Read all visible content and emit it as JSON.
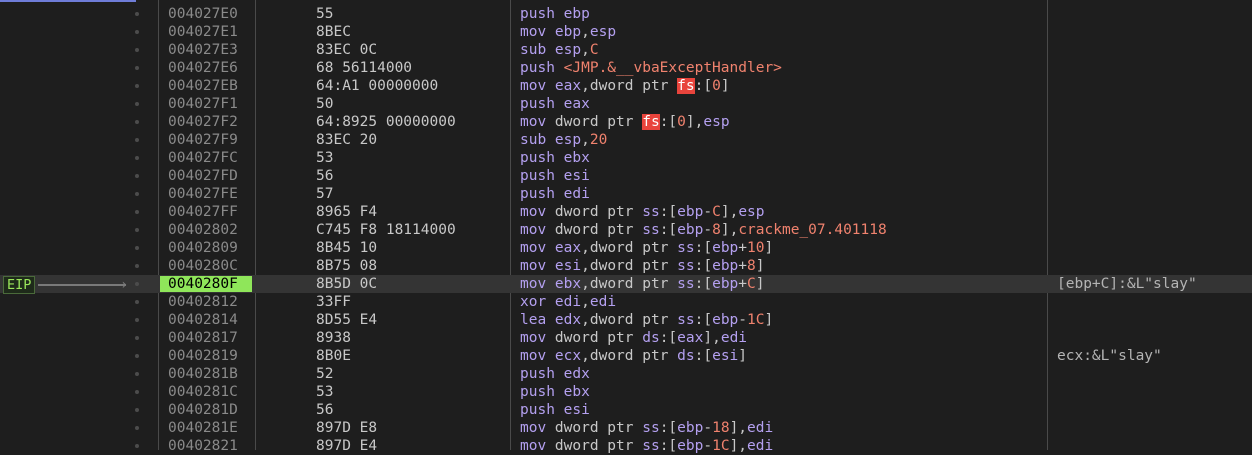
{
  "eip": {
    "label": "EIP",
    "arrow": "›"
  },
  "rows": [
    {
      "addr": "004027E0",
      "bytes": "55",
      "dis": [
        {
          "t": "mn",
          "v": "push "
        },
        {
          "t": "op",
          "v": "ebp"
        }
      ],
      "comment": ""
    },
    {
      "addr": "004027E1",
      "bytes": "8BEC",
      "dis": [
        {
          "t": "mn",
          "v": "mov "
        },
        {
          "t": "op",
          "v": "ebp"
        },
        {
          "t": "pl",
          "v": ","
        },
        {
          "t": "op",
          "v": "esp"
        }
      ],
      "comment": ""
    },
    {
      "addr": "004027E3",
      "bytes": "83EC 0C",
      "dis": [
        {
          "t": "mn",
          "v": "sub "
        },
        {
          "t": "op",
          "v": "esp"
        },
        {
          "t": "pl",
          "v": ","
        },
        {
          "t": "num",
          "v": "C"
        }
      ],
      "comment": ""
    },
    {
      "addr": "004027E6",
      "bytes": "68 56114000",
      "dis": [
        {
          "t": "mn",
          "v": "push "
        },
        {
          "t": "sym",
          "v": "<JMP.&__vbaExceptHandler>"
        }
      ],
      "comment": ""
    },
    {
      "addr": "004027EB",
      "bytes": "64:A1 00000000",
      "dis": [
        {
          "t": "mn",
          "v": "mov "
        },
        {
          "t": "op",
          "v": "eax"
        },
        {
          "t": "pl",
          "v": ",dword ptr "
        },
        {
          "t": "seg",
          "v": "fs"
        },
        {
          "t": "pl",
          "v": ":["
        },
        {
          "t": "num",
          "v": "0"
        },
        {
          "t": "pl",
          "v": "]"
        }
      ],
      "comment": ""
    },
    {
      "addr": "004027F1",
      "bytes": "50",
      "dis": [
        {
          "t": "mn",
          "v": "push "
        },
        {
          "t": "op",
          "v": "eax"
        }
      ],
      "comment": ""
    },
    {
      "addr": "004027F2",
      "bytes": "64:8925 00000000",
      "dis": [
        {
          "t": "mn",
          "v": "mov "
        },
        {
          "t": "pl",
          "v": "dword ptr "
        },
        {
          "t": "seg",
          "v": "fs"
        },
        {
          "t": "pl",
          "v": ":["
        },
        {
          "t": "num",
          "v": "0"
        },
        {
          "t": "pl",
          "v": "],"
        },
        {
          "t": "op",
          "v": "esp"
        }
      ],
      "comment": ""
    },
    {
      "addr": "004027F9",
      "bytes": "83EC 20",
      "dis": [
        {
          "t": "mn",
          "v": "sub "
        },
        {
          "t": "op",
          "v": "esp"
        },
        {
          "t": "pl",
          "v": ","
        },
        {
          "t": "num",
          "v": "20"
        }
      ],
      "comment": ""
    },
    {
      "addr": "004027FC",
      "bytes": "53",
      "dis": [
        {
          "t": "mn",
          "v": "push "
        },
        {
          "t": "op",
          "v": "ebx"
        }
      ],
      "comment": ""
    },
    {
      "addr": "004027FD",
      "bytes": "56",
      "dis": [
        {
          "t": "mn",
          "v": "push "
        },
        {
          "t": "op",
          "v": "esi"
        }
      ],
      "comment": ""
    },
    {
      "addr": "004027FE",
      "bytes": "57",
      "dis": [
        {
          "t": "mn",
          "v": "push "
        },
        {
          "t": "op",
          "v": "edi"
        }
      ],
      "comment": ""
    },
    {
      "addr": "004027FF",
      "bytes": "8965 F4",
      "dis": [
        {
          "t": "mn",
          "v": "mov "
        },
        {
          "t": "pl",
          "v": "dword ptr "
        },
        {
          "t": "op",
          "v": "ss"
        },
        {
          "t": "pl",
          "v": ":["
        },
        {
          "t": "op",
          "v": "ebp"
        },
        {
          "t": "pl",
          "v": "-"
        },
        {
          "t": "num",
          "v": "C"
        },
        {
          "t": "pl",
          "v": "],"
        },
        {
          "t": "op",
          "v": "esp"
        }
      ],
      "comment": ""
    },
    {
      "addr": "00402802",
      "bytes": "C745 F8 18114000",
      "dis": [
        {
          "t": "mn",
          "v": "mov "
        },
        {
          "t": "pl",
          "v": "dword ptr "
        },
        {
          "t": "op",
          "v": "ss"
        },
        {
          "t": "pl",
          "v": ":["
        },
        {
          "t": "op",
          "v": "ebp"
        },
        {
          "t": "pl",
          "v": "-"
        },
        {
          "t": "num",
          "v": "8"
        },
        {
          "t": "pl",
          "v": "],"
        },
        {
          "t": "sym",
          "v": "crackme_07.401118"
        }
      ],
      "comment": ""
    },
    {
      "addr": "00402809",
      "bytes": "8B45 10",
      "dis": [
        {
          "t": "mn",
          "v": "mov "
        },
        {
          "t": "op",
          "v": "eax"
        },
        {
          "t": "pl",
          "v": ",dword ptr "
        },
        {
          "t": "op",
          "v": "ss"
        },
        {
          "t": "pl",
          "v": ":["
        },
        {
          "t": "op",
          "v": "ebp"
        },
        {
          "t": "pl",
          "v": "+"
        },
        {
          "t": "num",
          "v": "10"
        },
        {
          "t": "pl",
          "v": "]"
        }
      ],
      "comment": ""
    },
    {
      "addr": "0040280C",
      "bytes": "8B75 08",
      "dis": [
        {
          "t": "mn",
          "v": "mov "
        },
        {
          "t": "op",
          "v": "esi"
        },
        {
          "t": "pl",
          "v": ",dword ptr "
        },
        {
          "t": "op",
          "v": "ss"
        },
        {
          "t": "pl",
          "v": ":["
        },
        {
          "t": "op",
          "v": "ebp"
        },
        {
          "t": "pl",
          "v": "+"
        },
        {
          "t": "num",
          "v": "8"
        },
        {
          "t": "pl",
          "v": "]"
        }
      ],
      "comment": ""
    },
    {
      "addr": "0040280F",
      "bytes": "8B5D 0C",
      "current": true,
      "dis": [
        {
          "t": "mn",
          "v": "mov "
        },
        {
          "t": "op",
          "v": "ebx"
        },
        {
          "t": "pl",
          "v": ",dword ptr "
        },
        {
          "t": "op",
          "v": "ss"
        },
        {
          "t": "pl",
          "v": ":["
        },
        {
          "t": "op",
          "v": "ebp"
        },
        {
          "t": "pl",
          "v": "+"
        },
        {
          "t": "num",
          "v": "C"
        },
        {
          "t": "pl",
          "v": "]"
        }
      ],
      "comment": "[ebp+C]:&L\"slay\""
    },
    {
      "addr": "00402812",
      "bytes": "33FF",
      "dis": [
        {
          "t": "mn",
          "v": "xor "
        },
        {
          "t": "op",
          "v": "edi"
        },
        {
          "t": "pl",
          "v": ","
        },
        {
          "t": "op",
          "v": "edi"
        }
      ],
      "comment": ""
    },
    {
      "addr": "00402814",
      "bytes": "8D55 E4",
      "dis": [
        {
          "t": "mn",
          "v": "lea "
        },
        {
          "t": "op",
          "v": "edx"
        },
        {
          "t": "pl",
          "v": ",dword ptr "
        },
        {
          "t": "op",
          "v": "ss"
        },
        {
          "t": "pl",
          "v": ":["
        },
        {
          "t": "op",
          "v": "ebp"
        },
        {
          "t": "pl",
          "v": "-"
        },
        {
          "t": "num",
          "v": "1C"
        },
        {
          "t": "pl",
          "v": "]"
        }
      ],
      "comment": ""
    },
    {
      "addr": "00402817",
      "bytes": "8938",
      "dis": [
        {
          "t": "mn",
          "v": "mov "
        },
        {
          "t": "pl",
          "v": "dword ptr "
        },
        {
          "t": "op",
          "v": "ds"
        },
        {
          "t": "pl",
          "v": ":["
        },
        {
          "t": "op",
          "v": "eax"
        },
        {
          "t": "pl",
          "v": "],"
        },
        {
          "t": "op",
          "v": "edi"
        }
      ],
      "comment": ""
    },
    {
      "addr": "00402819",
      "bytes": "8B0E",
      "dis": [
        {
          "t": "mn",
          "v": "mov "
        },
        {
          "t": "op",
          "v": "ecx"
        },
        {
          "t": "pl",
          "v": ",dword ptr "
        },
        {
          "t": "op",
          "v": "ds"
        },
        {
          "t": "pl",
          "v": ":["
        },
        {
          "t": "op",
          "v": "esi"
        },
        {
          "t": "pl",
          "v": "]"
        }
      ],
      "comment": "ecx:&L\"slay\""
    },
    {
      "addr": "0040281B",
      "bytes": "52",
      "dis": [
        {
          "t": "mn",
          "v": "push "
        },
        {
          "t": "op",
          "v": "edx"
        }
      ],
      "comment": ""
    },
    {
      "addr": "0040281C",
      "bytes": "53",
      "dis": [
        {
          "t": "mn",
          "v": "push "
        },
        {
          "t": "op",
          "v": "ebx"
        }
      ],
      "comment": ""
    },
    {
      "addr": "0040281D",
      "bytes": "56",
      "dis": [
        {
          "t": "mn",
          "v": "push "
        },
        {
          "t": "op",
          "v": "esi"
        }
      ],
      "comment": ""
    },
    {
      "addr": "0040281E",
      "bytes": "897D E8",
      "dis": [
        {
          "t": "mn",
          "v": "mov "
        },
        {
          "t": "pl",
          "v": "dword ptr "
        },
        {
          "t": "op",
          "v": "ss"
        },
        {
          "t": "pl",
          "v": ":["
        },
        {
          "t": "op",
          "v": "ebp"
        },
        {
          "t": "pl",
          "v": "-"
        },
        {
          "t": "num",
          "v": "18"
        },
        {
          "t": "pl",
          "v": "],"
        },
        {
          "t": "op",
          "v": "edi"
        }
      ],
      "comment": ""
    },
    {
      "addr": "00402821",
      "bytes": "897D E4",
      "dis": [
        {
          "t": "mn",
          "v": "mov "
        },
        {
          "t": "pl",
          "v": "dword ptr "
        },
        {
          "t": "op",
          "v": "ss"
        },
        {
          "t": "pl",
          "v": ":["
        },
        {
          "t": "op",
          "v": "ebp"
        },
        {
          "t": "pl",
          "v": "-"
        },
        {
          "t": "num",
          "v": "1C"
        },
        {
          "t": "pl",
          "v": "],"
        },
        {
          "t": "op",
          "v": "edi"
        }
      ],
      "comment": ""
    }
  ]
}
